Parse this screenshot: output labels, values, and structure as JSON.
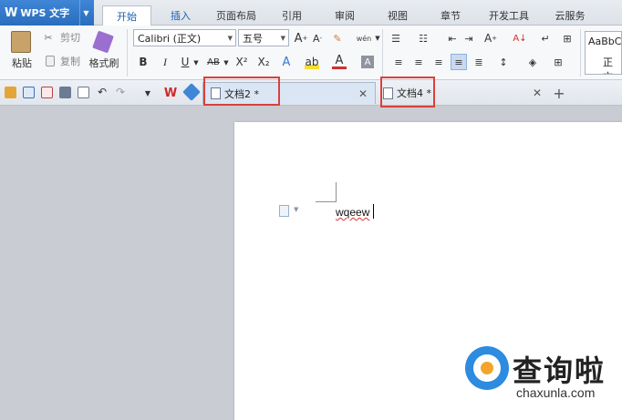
{
  "app": {
    "logo": "W",
    "title": "WPS 文字"
  },
  "tabs": [
    "开始",
    "插入",
    "页面布局",
    "引用",
    "审阅",
    "视图",
    "章节",
    "开发工具",
    "云服务"
  ],
  "ribbon": {
    "paste": "粘贴",
    "cut": "剪切",
    "copy": "复制",
    "format_painter": "格式刷",
    "font_name": "Calibri (正文)",
    "font_size": "五号",
    "bold": "B",
    "italic": "I",
    "underline": "U",
    "strike": "AB",
    "superscript": "X²",
    "subscript": "X₂",
    "style_preview": "AaBbC",
    "style_name": "正文"
  },
  "doc_tabs": [
    {
      "name": "文档2 *"
    },
    {
      "name": "文档4 *"
    }
  ],
  "document": {
    "text": "wqeew"
  },
  "watermark": {
    "brand": "查询啦",
    "url": "chaxunla.com"
  },
  "colors": {
    "app_blue": "#2a6dbd",
    "highlight_red": "#d9413b",
    "active_tab_text": "#1c5fb5"
  }
}
